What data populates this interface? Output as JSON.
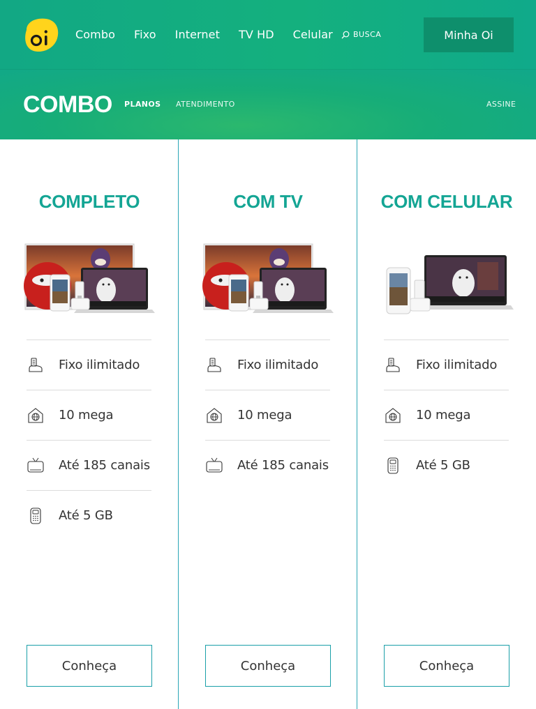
{
  "brand": {
    "logo_text": "oi",
    "primary": "#12a884",
    "accent": "#14a594"
  },
  "nav": {
    "items": [
      {
        "label": "Combo"
      },
      {
        "label": "Fixo"
      },
      {
        "label": "Internet"
      },
      {
        "label": "TV HD"
      },
      {
        "label": "Celular"
      }
    ],
    "search_label": "BUSCA",
    "account_label": "Minha Oi"
  },
  "subnav": {
    "title": "COMBO",
    "tabs": [
      {
        "label": "PLANOS",
        "active": true
      },
      {
        "label": "ATENDIMENTO",
        "active": false
      }
    ],
    "cta_label": "ASSINE"
  },
  "plans": [
    {
      "title": "COMPLETO",
      "image": "tv-laptop-phone-landline-devices",
      "features": [
        {
          "icon": "landline-phone-icon",
          "label": "Fixo ilimitado"
        },
        {
          "icon": "home-internet-icon",
          "label": "10 mega"
        },
        {
          "icon": "tv-icon",
          "label": "Até 185 canais"
        },
        {
          "icon": "mobile-phone-icon",
          "label": "Até 5 GB"
        }
      ],
      "button_label": "Conheça"
    },
    {
      "title": "COM TV",
      "image": "tv-laptop-phone-landline-devices",
      "features": [
        {
          "icon": "landline-phone-icon",
          "label": "Fixo ilimitado"
        },
        {
          "icon": "home-internet-icon",
          "label": "10 mega"
        },
        {
          "icon": "tv-icon",
          "label": "Até 185 canais"
        }
      ],
      "button_label": "Conheça"
    },
    {
      "title": "COM CELULAR",
      "image": "laptop-phone-landline-devices",
      "features": [
        {
          "icon": "landline-phone-icon",
          "label": "Fixo ilimitado"
        },
        {
          "icon": "home-internet-icon",
          "label": "10 mega"
        },
        {
          "icon": "mobile-phone-icon",
          "label": "Até 5 GB"
        }
      ],
      "button_label": "Conheça"
    }
  ]
}
